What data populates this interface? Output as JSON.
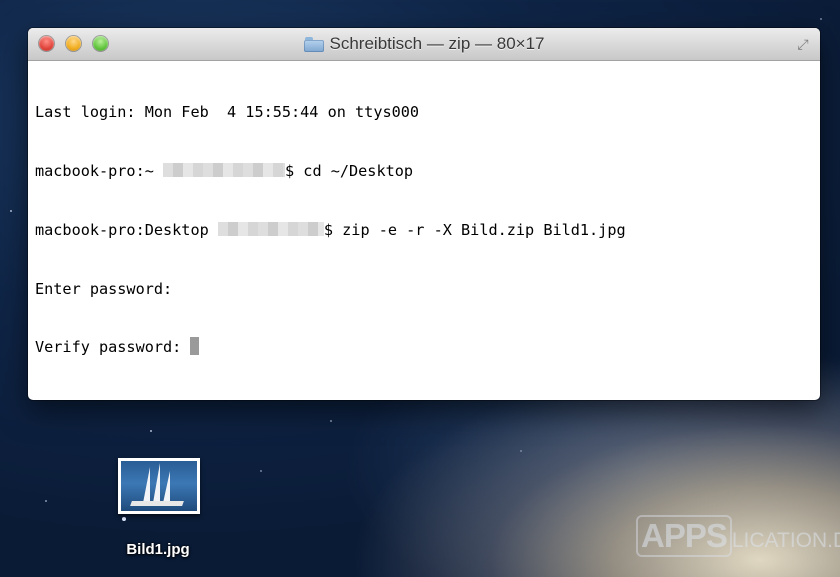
{
  "window": {
    "title": "Schreibtisch — zip — 80×17",
    "icons": {
      "folder": "folder-icon",
      "close": "close-icon",
      "minimize": "minimize-icon",
      "zoom": "zoom-icon",
      "fullscreen": "fullscreen-icon"
    }
  },
  "terminal": {
    "lines": [
      {
        "text": "Last login: Mon Feb  4 15:55:44 on ttys000"
      },
      {
        "prefix": "macbook-pro:~ ",
        "suffix": "$ cd ~/Desktop"
      },
      {
        "prefix": "macbook-pro:Desktop ",
        "suffix": "$ zip -e -r -X Bild.zip Bild1.jpg"
      },
      {
        "text": "Enter password:"
      },
      {
        "text": "Verify password: "
      }
    ]
  },
  "desktop": {
    "file_name": "Bild1.jpg"
  },
  "watermark": {
    "brand": "APPS",
    "brand_rest": "LICATION.DE"
  },
  "colors": {
    "close": "#e0443b",
    "minimize": "#f0ac1d",
    "zoom": "#5fc43a"
  }
}
